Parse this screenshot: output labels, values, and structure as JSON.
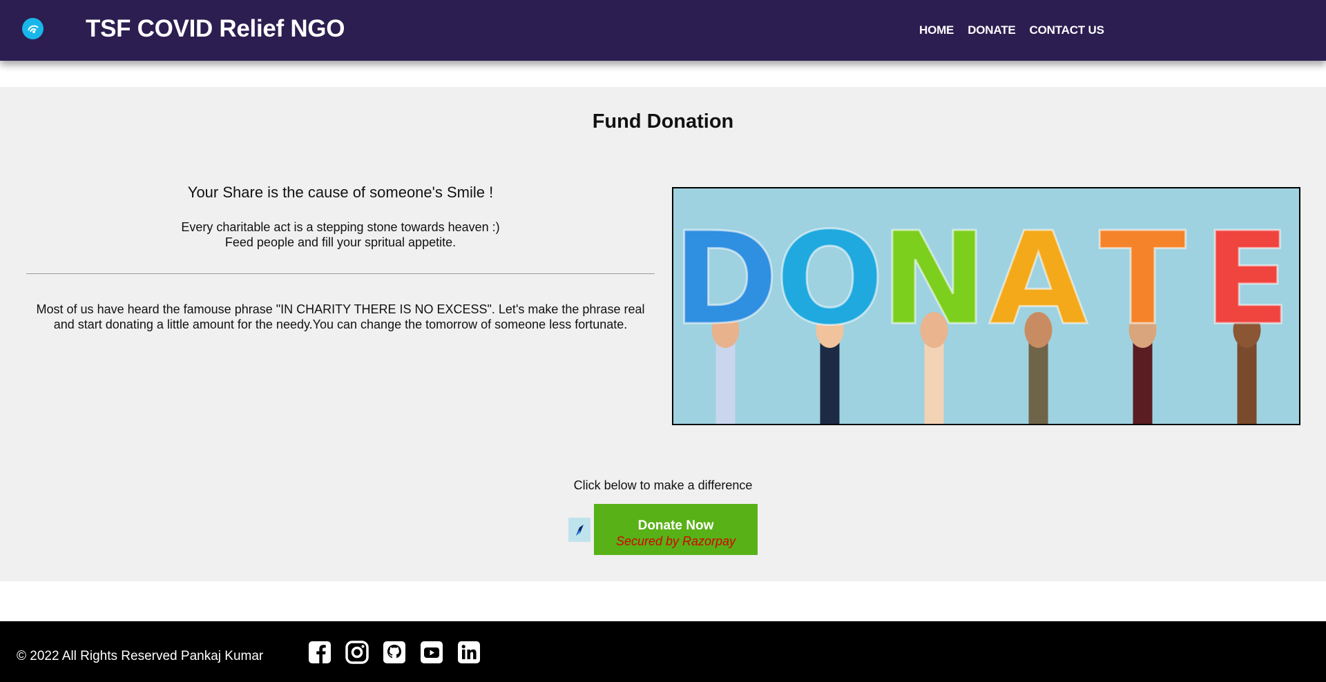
{
  "header": {
    "brand": "TSF COVID Relief NGO",
    "logo_icon": "relief-logo-icon",
    "nav": [
      {
        "label": "HOME"
      },
      {
        "label": "DONATE"
      },
      {
        "label": "CONTACT US"
      }
    ]
  },
  "main": {
    "title": "Fund Donation",
    "tagline": "Your Share is the cause of someone's Smile !",
    "sub_line_1": "Every charitable act is a stepping stone towards heaven :)",
    "sub_line_2": "Feed people and fill your spritual appetite.",
    "paragraph": "Most of us have heard the famouse phrase \"IN CHARITY THERE IS NO EXCESS\". Let's make the phrase real and start donating a little amount for the needy.You can change the tomorrow of someone less fortunate.",
    "hero_letters": [
      "D",
      "O",
      "N",
      "A",
      "T",
      "E"
    ],
    "hero_colors": [
      "#2f8fe0",
      "#1fa9de",
      "#7ccf1d",
      "#f3a91a",
      "#f5832a",
      "#f0443f"
    ]
  },
  "cta": {
    "text": "Click below to make a difference",
    "button_label": "Donate Now",
    "button_sub": "Secured by Razorpay",
    "brand_color": "#58b116"
  },
  "footer": {
    "copyright": "© 2022 All Rights Reserved Pankaj Kumar",
    "socials": [
      "facebook-icon",
      "instagram-icon",
      "github-icon",
      "youtube-icon",
      "linkedin-icon"
    ]
  },
  "colors": {
    "header_bg": "#2c1e50",
    "main_bg": "#f0f0f0",
    "footer_bg": "#000000",
    "hero_bg": "#9fd2e0"
  }
}
